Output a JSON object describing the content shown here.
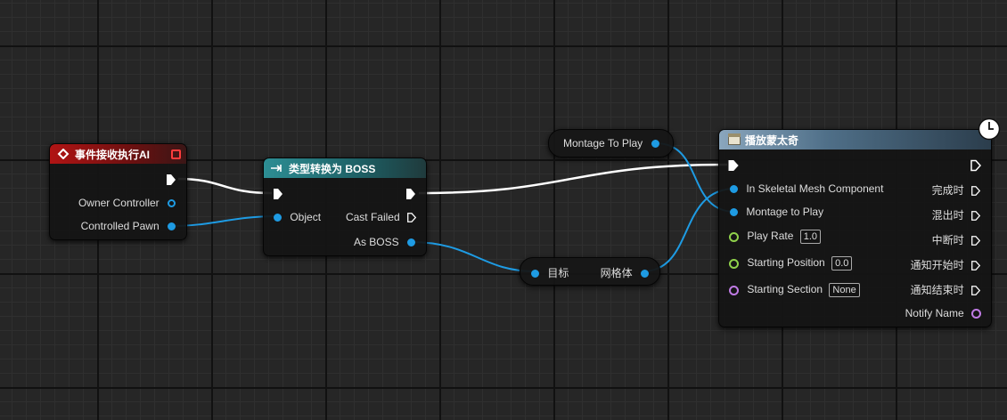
{
  "event_node": {
    "title": "事件接收执行AI",
    "pins": {
      "owner_controller": "Owner Controller",
      "controlled_pawn": "Controlled Pawn"
    }
  },
  "cast_node": {
    "title": "类型转换为 BOSS",
    "pins": {
      "object": "Object",
      "cast_failed": "Cast Failed",
      "as_boss": "As BOSS"
    }
  },
  "montage_var": {
    "label": "Montage To Play"
  },
  "mesh_node": {
    "input_label": "目标",
    "output_label": "网格体"
  },
  "play_montage_node": {
    "title": "播放蒙太奇",
    "inputs": {
      "skeletal_mesh": "In Skeletal Mesh Component",
      "montage": "Montage to Play",
      "play_rate": "Play Rate",
      "play_rate_value": "1.0",
      "starting_position": "Starting Position",
      "starting_position_value": "0.0",
      "starting_section": "Starting Section",
      "starting_section_value": "None"
    },
    "outputs": {
      "completed": "完成时",
      "blend_out": "混出时",
      "interrupted": "中断时",
      "notify_begin": "通知开始时",
      "notify_end": "通知结束时",
      "notify_name": "Notify Name"
    }
  },
  "colors": {
    "exec": "#ffffff",
    "object_pin": "#1e9be3",
    "float_pin": "#8fd14b",
    "name_pin": "#c07be5",
    "event_header": "#b11414",
    "cast_header": "#2d8e94",
    "function_header": "#8aa6bd"
  }
}
